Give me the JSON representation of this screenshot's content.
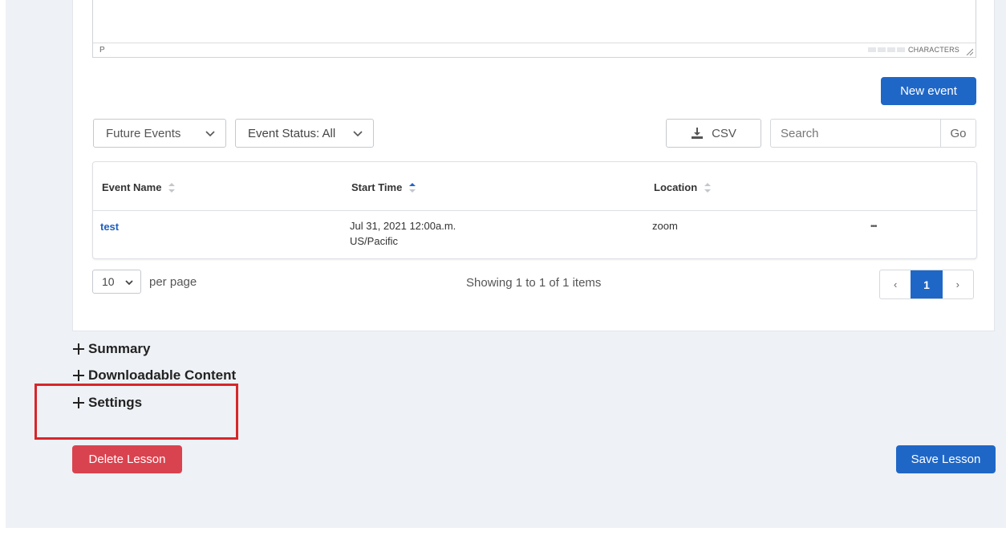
{
  "editor": {
    "path": "P",
    "counter_label": "CHARACTERS"
  },
  "toolbar": {
    "new_event_label": "New event",
    "time_filter": "Future Events",
    "status_filter": "Event Status: All",
    "csv_label": "CSV",
    "search_placeholder": "Search",
    "go_label": "Go"
  },
  "table": {
    "columns": [
      "Event Name",
      "Start Time",
      "Location"
    ],
    "rows": [
      {
        "name": "test",
        "start_time_line1": "Jul 31, 2021 12:00a.m.",
        "start_time_line2": "US/Pacific",
        "location": "zoom",
        "more": "•••"
      }
    ]
  },
  "pagination": {
    "per_page_value": "10",
    "per_page_label": "per page",
    "showing_text": "Showing 1 to 1 of 1 items",
    "prev": "‹",
    "current": "1",
    "next": "›"
  },
  "sections": [
    "Summary",
    "Downloadable Content",
    "Settings"
  ],
  "actions": {
    "delete_label": "Delete Lesson",
    "save_label": "Save Lesson"
  },
  "colors": {
    "primary": "#1f67c7",
    "danger": "#d9434f",
    "highlight": "#d7262a",
    "page_bg": "#eef1f5"
  },
  "icons": {
    "download": "download-icon",
    "chevron": "chevron-down-icon",
    "sort": "sort-icon",
    "plus": "plus-icon"
  }
}
